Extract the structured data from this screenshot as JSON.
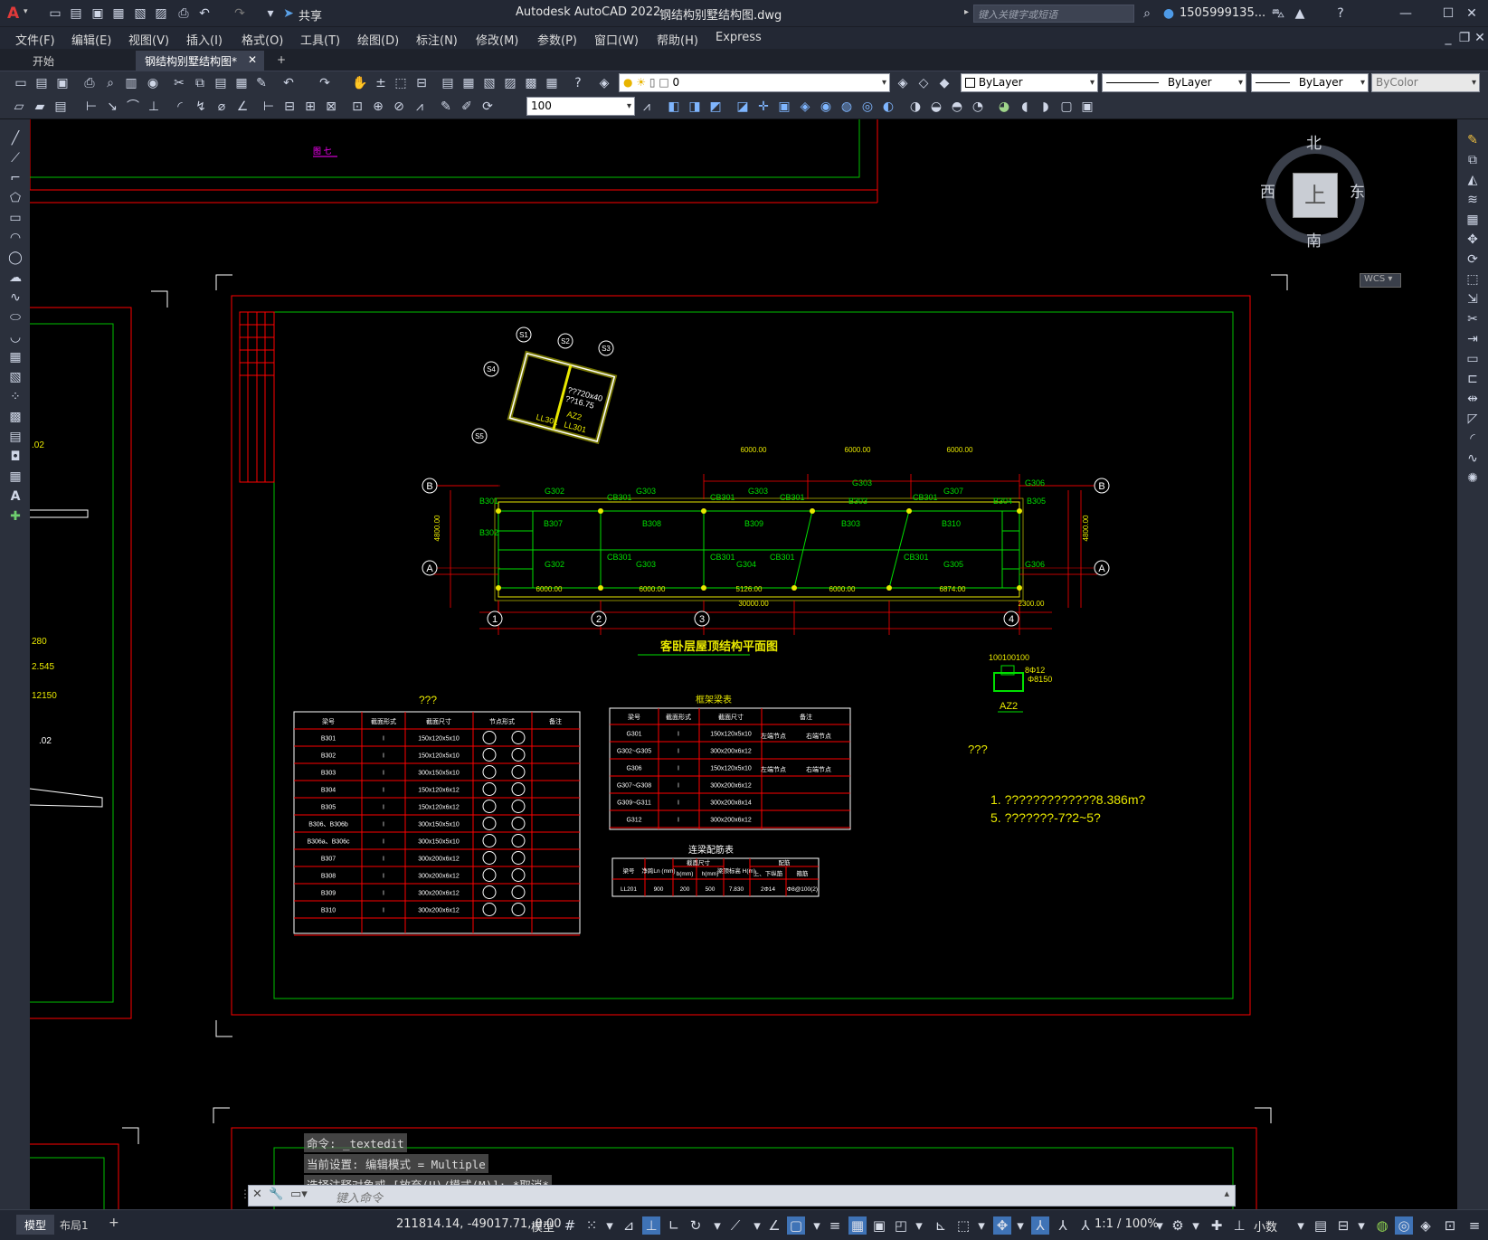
{
  "title": {
    "app": "Autodesk AutoCAD 2022",
    "file": "钢结构别墅结构图.dwg",
    "share": "共享",
    "search_placeholder": "键入关键字或短语",
    "user": "1505999135..."
  },
  "menu": [
    "文件(F)",
    "编辑(E)",
    "视图(V)",
    "插入(I)",
    "格式(O)",
    "工具(T)",
    "绘图(D)",
    "标注(N)",
    "修改(M)",
    "参数(P)",
    "窗口(W)",
    "帮助(H)",
    "Express"
  ],
  "tabs": {
    "start": "开始",
    "doc": "钢结构别墅结构图*",
    "add": "+"
  },
  "toolbar": {
    "layer_value": "0",
    "color_value": "ByLayer",
    "linetype_value": "ByLayer",
    "lineweight_value": "ByLayer",
    "plotstyle_value": "ByColor",
    "scale_value": "100"
  },
  "viewcube": {
    "north": "北",
    "south": "南",
    "east": "东",
    "west": "西",
    "top": "上",
    "wcs": "WCS"
  },
  "drawing": {
    "plan_title": "客卧层屋顶结构平面图",
    "grid_rows": [
      "B",
      "A"
    ],
    "grid_cols": [
      "1",
      "2",
      "3",
      "4"
    ],
    "sgrid": [
      "S1",
      "S2",
      "S3",
      "S4",
      "S5"
    ],
    "dims_top": [
      "6000.00",
      "6000.00",
      "6000.00"
    ],
    "dims_bottom": [
      "6000.00",
      "6000.00",
      "5126.00",
      "6000.00",
      "6874.00"
    ],
    "dim_total": "30000.00",
    "dim_end": "2300.00",
    "dim_h": "4800.00",
    "beams_g": [
      "G302",
      "G303",
      "G303",
      "G303",
      "G303",
      "G307",
      "G306",
      "G302",
      "G301",
      "G303",
      "G304",
      "G305",
      "G306"
    ],
    "beams_b": [
      "B307",
      "B308",
      "B309",
      "B303",
      "B310",
      "B303",
      "B304",
      "B305",
      "B306",
      "B301",
      "B302"
    ],
    "cbs": [
      "CB301",
      "CB301",
      "CB301",
      "CB301",
      "CB301",
      "CB301",
      "CB301",
      "CB301"
    ],
    "left_labels": [
      ".02",
      "280",
      "2.545",
      "12150",
      ".02"
    ],
    "az2_label": "AZ2",
    "az2_dims": [
      "100100100",
      "8Φ12",
      "Φ8150"
    ],
    "table1_title": "???",
    "table1_headers": [
      "梁号",
      "截面形式",
      "截面尺寸",
      "节点形式",
      "备注"
    ],
    "table1_rows": [
      [
        "B301",
        "I",
        "150x120x5x10"
      ],
      [
        "B302",
        "I",
        "150x120x5x10"
      ],
      [
        "B303",
        "I",
        "300x150x5x10"
      ],
      [
        "B304",
        "I",
        "150x120x6x12"
      ],
      [
        "B305",
        "I",
        "150x120x6x12"
      ],
      [
        "B306、B306b",
        "I",
        "300x150x5x10"
      ],
      [
        "B306a、B306c",
        "I",
        "300x150x5x10"
      ],
      [
        "B307",
        "I",
        "300x200x6x12"
      ],
      [
        "B308",
        "I",
        "300x200x6x12"
      ],
      [
        "B309",
        "I",
        "300x200x6x12"
      ],
      [
        "B310",
        "I",
        "300x200x6x12"
      ]
    ],
    "table2_title": "框架梁表",
    "table2_headers": [
      "梁号",
      "截面形式",
      "截面尺寸",
      "备注"
    ],
    "table2_rows": [
      [
        "G301",
        "I",
        "150x120x5x10"
      ],
      [
        "G302~G305",
        "I",
        "300x200x6x12"
      ],
      [
        "G306",
        "I",
        "150x120x5x10"
      ],
      [
        "G307~G308",
        "I",
        "300x200x6x12"
      ],
      [
        "G309~G311",
        "I",
        "300x200x8x14"
      ],
      [
        "G312",
        "I",
        "300x200x6x12"
      ]
    ],
    "table2_note": "左端节点",
    "table2_note_r": "右端节点",
    "table3_title": "连梁配筋表",
    "table3_headers": [
      "梁号",
      "净跨Ln (mm)",
      "b(mm)",
      "h(mm)",
      "梁顶标高 H(m)",
      "上、下纵筋",
      "箍筋"
    ],
    "table3_row": [
      "LL201",
      "900",
      "200",
      "500",
      "7.830",
      "2Φ14",
      "Φ8@100(2)"
    ],
    "table3_group": "截面尺寸",
    "table3_group2": "配筋",
    "notes_title": "???",
    "notes": [
      "1. ?????????????8.386m?",
      "5. ???????-7?2~5?"
    ],
    "side_block_text": [
      "??720x40",
      "??16.75",
      "AZ2",
      "LL301",
      "LL301"
    ],
    "tiny_label": "图 七"
  },
  "command": {
    "history": [
      "命令: _textedit",
      "当前设置: 编辑模式 = Multiple",
      "选择注释对象或 [放弃(U)/模式(M)]: *取消*"
    ],
    "placeholder": "键入命令"
  },
  "status": {
    "tab_model": "模型",
    "tab_layout": "布局1",
    "coords": "211814.14, -49017.71, 0.00",
    "mode": "模型",
    "scale": "1:1 / 100%",
    "units": "小数"
  }
}
